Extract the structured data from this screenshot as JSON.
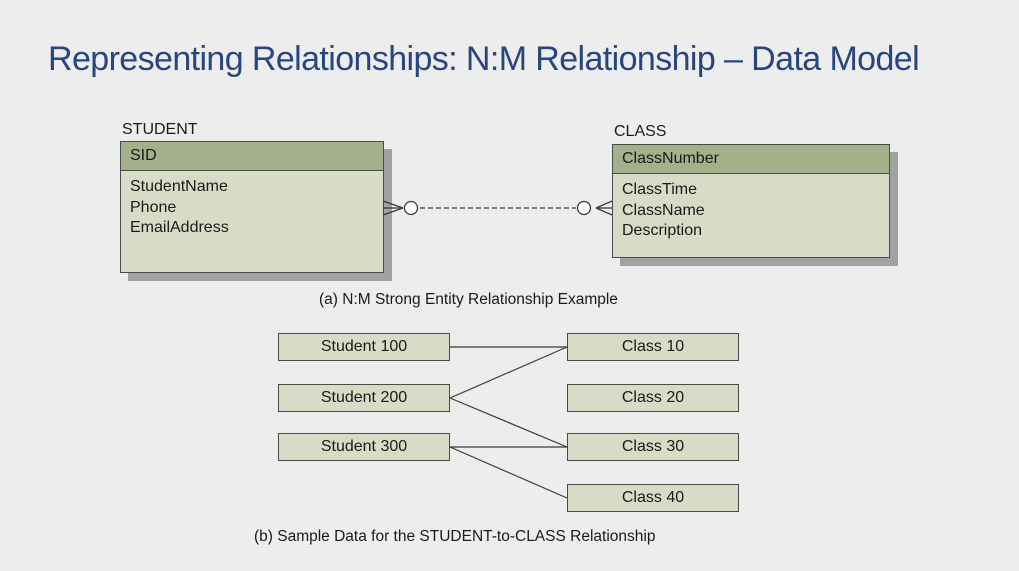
{
  "title": "Representing Relationships: N:M Relationship – Data Model",
  "figure_a": {
    "caption": "(a) N:M Strong Entity Relationship Example",
    "student": {
      "name": "STUDENT",
      "key": "SID",
      "attributes": [
        "StudentName",
        "Phone",
        "EmailAddress"
      ]
    },
    "class": {
      "name": "CLASS",
      "key": "ClassNumber",
      "attributes": [
        "ClassTime",
        "ClassName",
        "Description"
      ]
    }
  },
  "figure_b": {
    "caption": "(b) Sample Data for the STUDENT-to-CLASS Relationship",
    "students": [
      "Student 100",
      "Student 200",
      "Student 300"
    ],
    "classes": [
      "Class 10",
      "Class 20",
      "Class 30",
      "Class 40"
    ],
    "links": [
      {
        "student": "Student 100",
        "class": "Class 10"
      },
      {
        "student": "Student 200",
        "class": "Class 10"
      },
      {
        "student": "Student 200",
        "class": "Class 30"
      },
      {
        "student": "Student 300",
        "class": "Class 30"
      },
      {
        "student": "Student 300",
        "class": "Class 40"
      }
    ]
  }
}
